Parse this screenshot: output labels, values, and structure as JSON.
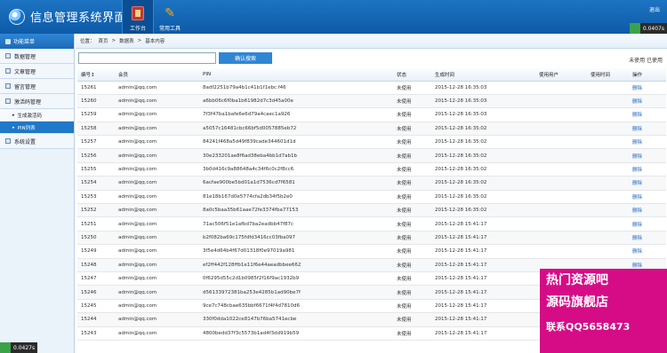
{
  "app": {
    "title": "信息管理系统界面"
  },
  "topnav": [
    {
      "label": "工作台",
      "icon": "book-icon"
    },
    {
      "label": "常用工具",
      "icon": "tools-icon"
    }
  ],
  "header": {
    "user": "退出",
    "counter": "0.0407s"
  },
  "sidebar": {
    "title": "功能菜单",
    "items": [
      {
        "label": "数据管理"
      },
      {
        "label": "文章管理"
      },
      {
        "label": "留言管理"
      },
      {
        "label": "激活码管理"
      }
    ],
    "subitems": [
      {
        "label": "生成激活码",
        "active": false
      },
      {
        "label": "PIN列表",
        "active": true
      }
    ],
    "after": {
      "label": "系统设置"
    },
    "footer_counter": "0.0427s"
  },
  "breadcrumb": [
    "位置：",
    "首页",
    ">",
    "数据表",
    ">",
    "基本内容"
  ],
  "search": {
    "placeholder": "",
    "button": "确认搜索"
  },
  "filters": "未使用 已使用",
  "table": {
    "headers": [
      "编号↕",
      "会员",
      "PIN",
      "状态",
      "生成时间",
      "使用用户",
      "使用时间",
      "操作"
    ],
    "rows": [
      [
        "15261",
        "admin@qq.com",
        "8adf2251b79a4b1c41b1f1ebc f46",
        "未使用",
        "2015-12-28 16:35:03",
        "",
        "",
        "删除"
      ],
      [
        "15260",
        "admin@qq.com",
        "a6bb06c6f0ba1b61982d7c3d45a00e",
        "未使用",
        "2015-12-28 16:35:03",
        "",
        "",
        "删除"
      ],
      [
        "15259",
        "admin@qq.com",
        "7f3f47ba1bafe6e6d79a4caec1a926",
        "未使用",
        "2015-12-28 16:35:03",
        "",
        "",
        "删除"
      ],
      [
        "15258",
        "admin@qq.com",
        "a5057c16481cbc66bf5d0057885eb72",
        "未使用",
        "2015-12-28 16:35:02",
        "",
        "",
        "删除"
      ],
      [
        "15257",
        "admin@qq.com",
        "84241f468a5d49f839cade344601d1d",
        "未使用",
        "2015-12-28 16:35:02",
        "",
        "",
        "删除"
      ],
      [
        "15256",
        "admin@qq.com",
        "30e233201ae8f6ad38eba4bb1d7ab1b",
        "未使用",
        "2015-12-28 16:35:02",
        "",
        "",
        "删除"
      ],
      [
        "15255",
        "admin@qq.com",
        "3b0d416c9a88648a4c34f6c0c2f8cc6",
        "未使用",
        "2015-12-28 16:35:02",
        "",
        "",
        "删除"
      ],
      [
        "15254",
        "admin@qq.com",
        "6acfae900be5bd01a1d7536cd7f6581",
        "未使用",
        "2015-12-28 16:35:02",
        "",
        "",
        "删除"
      ],
      [
        "15253",
        "admin@qq.com",
        "81e18b167d0e5774cfa2db34f5b2e0",
        "未使用",
        "2015-12-28 16:35:02",
        "",
        "",
        "删除"
      ],
      [
        "15252",
        "admin@qq.com",
        "8a0c5baa35b61aae72fe3374fba77153",
        "未使用",
        "2015-12-28 16:35:02",
        "",
        "",
        "删除"
      ],
      [
        "15251",
        "admin@qq.com",
        "71ac506f51e1afbd7ba2eadbb47f87c",
        "未使用",
        "2015-12-28 15:41:17",
        "",
        "",
        "删除"
      ],
      [
        "15250",
        "admin@qq.com",
        "b2f082ba69c175fdfd3416cc03fba097",
        "未使用",
        "2015-12-28 15:41:17",
        "",
        "",
        "删除"
      ],
      [
        "15249",
        "admin@qq.com",
        "3f5e4d64b4f67d01318f0e97019a981",
        "未使用",
        "2015-12-28 15:41:17",
        "",
        "",
        "删除"
      ],
      [
        "15248",
        "admin@qq.com",
        "ef2ff442f128ffb1e11f6e44aeadbbee662",
        "未使用",
        "2015-12-28 15:41:17",
        "",
        "",
        "删除"
      ],
      [
        "15247",
        "admin@qq.com",
        "0f6295d55c2d1b0985f2f16f9ac1932b9",
        "未使用",
        "2015-12-28 15:41:17",
        "",
        "",
        "删除"
      ],
      [
        "15246",
        "admin@qq.com",
        "d56133972381ba253e4285b1ad90be7f",
        "未使用",
        "2015-12-28 15:41:17",
        "",
        "",
        "删除"
      ],
      [
        "15245",
        "admin@qq.com",
        "9ce7c748cbae635bbf6671f4f4d7810d6",
        "未使用",
        "2015-12-28 15:41:17",
        "",
        "",
        "删除"
      ],
      [
        "15244",
        "admin@qq.com",
        "330f0dda1022ce8147b76ba5741ecbe",
        "未使用",
        "2015-12-28 15:41:17",
        "",
        "",
        "删除"
      ],
      [
        "15243",
        "admin@qq.com",
        "4800bedd37f3c5573b1ad4f3dd919b59",
        "未使用",
        "2015-12-28 15:41:17",
        "",
        "",
        "删除"
      ]
    ]
  },
  "watermark": {
    "line1": "热门资源吧",
    "line2": "源码旗舰店",
    "line3": "联系QQ5658473"
  }
}
